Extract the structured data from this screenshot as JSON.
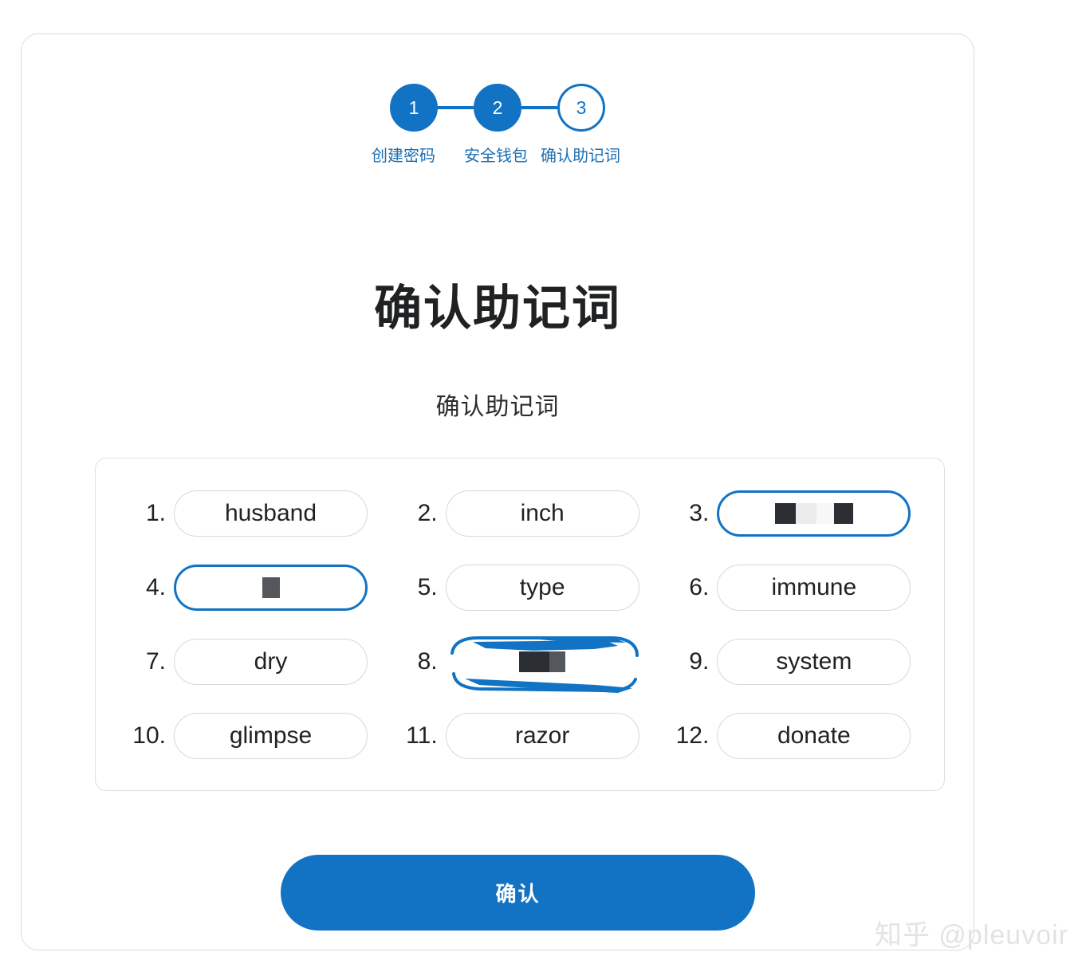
{
  "stepper": {
    "steps": [
      {
        "number": "1",
        "label": "创建密码",
        "state": "done"
      },
      {
        "number": "2",
        "label": "安全钱包",
        "state": "done"
      },
      {
        "number": "3",
        "label": "确认助记词",
        "state": "current"
      }
    ],
    "accent_color": "#1273c4",
    "label_color": "#1e6fb0"
  },
  "page": {
    "title": "确认助记词",
    "subtitle": "确认助记词"
  },
  "mnemonic": {
    "words": [
      {
        "index": "1.",
        "word": "husband",
        "state": "normal"
      },
      {
        "index": "2.",
        "word": "inch",
        "state": "normal"
      },
      {
        "index": "3.",
        "word": "",
        "state": "selected-redacted"
      },
      {
        "index": "4.",
        "word": "",
        "state": "selected-redacted"
      },
      {
        "index": "5.",
        "word": "type",
        "state": "normal"
      },
      {
        "index": "6.",
        "word": "immune",
        "state": "normal"
      },
      {
        "index": "7.",
        "word": "dry",
        "state": "normal"
      },
      {
        "index": "8.",
        "word": "",
        "state": "smeared-redacted"
      },
      {
        "index": "9.",
        "word": "system",
        "state": "normal"
      },
      {
        "index": "10.",
        "word": "glimpse",
        "state": "normal"
      },
      {
        "index": "11.",
        "word": "razor",
        "state": "normal"
      },
      {
        "index": "12.",
        "word": "donate",
        "state": "normal"
      }
    ]
  },
  "actions": {
    "confirm_label": "确认"
  },
  "watermark": {
    "text": "知乎 @pleuvoir"
  }
}
